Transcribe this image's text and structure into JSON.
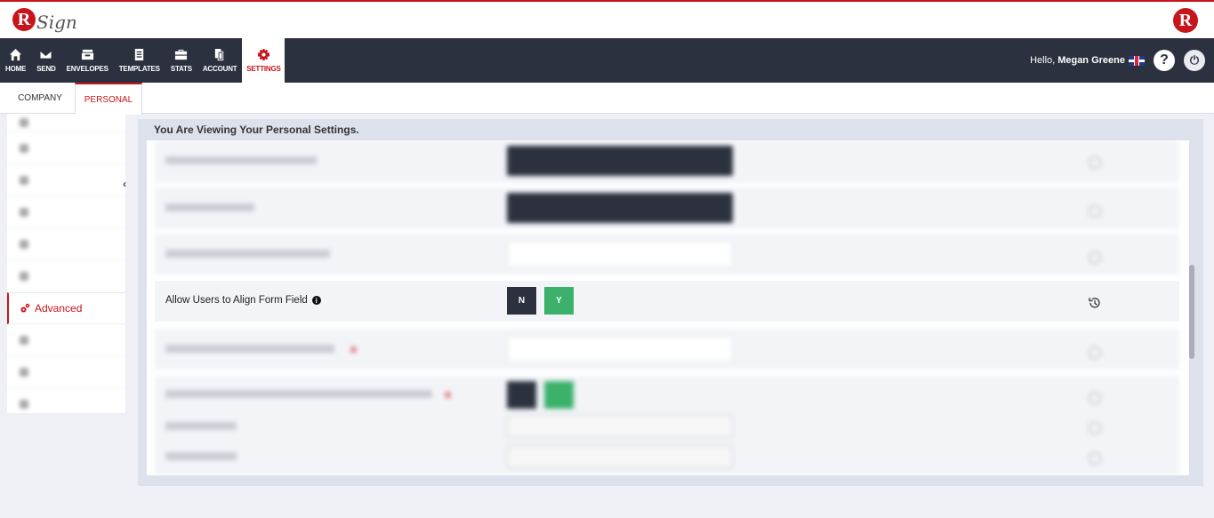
{
  "header": {
    "logo_letter": "R",
    "logo_script": "Sign",
    "brand_letter": "R"
  },
  "nav": {
    "items": [
      {
        "label": "HOME",
        "icon": "home-icon"
      },
      {
        "label": "SEND",
        "icon": "envelope-icon"
      },
      {
        "label": "ENVELOPES",
        "icon": "inbox-icon"
      },
      {
        "label": "TEMPLATES",
        "icon": "document-icon"
      },
      {
        "label": "STATS",
        "icon": "briefcase-icon"
      },
      {
        "label": "ACCOUNT",
        "icon": "copy-icon"
      },
      {
        "label": "SETTINGS",
        "icon": "gear-icon",
        "active": true
      }
    ],
    "greeting": "Hello,",
    "user_name": "Megan Greene",
    "help_symbol": "?",
    "power_symbol": "⏻"
  },
  "tabs": {
    "company": "COMPANY",
    "personal": "PERSONAL"
  },
  "sidebar": {
    "advanced_label": "Advanced",
    "collapse_symbol": "‹"
  },
  "main": {
    "title": "You Are Viewing Your Personal Settings.",
    "focused_setting": {
      "label": "Allow Users to Align Form Field",
      "info_symbol": "i",
      "no_label": "N",
      "yes_label": "Y",
      "selected": "Y"
    }
  },
  "colors": {
    "brand_red": "#c8141b",
    "nav_dark": "#2b313e",
    "yes_green": "#3bb16b"
  }
}
